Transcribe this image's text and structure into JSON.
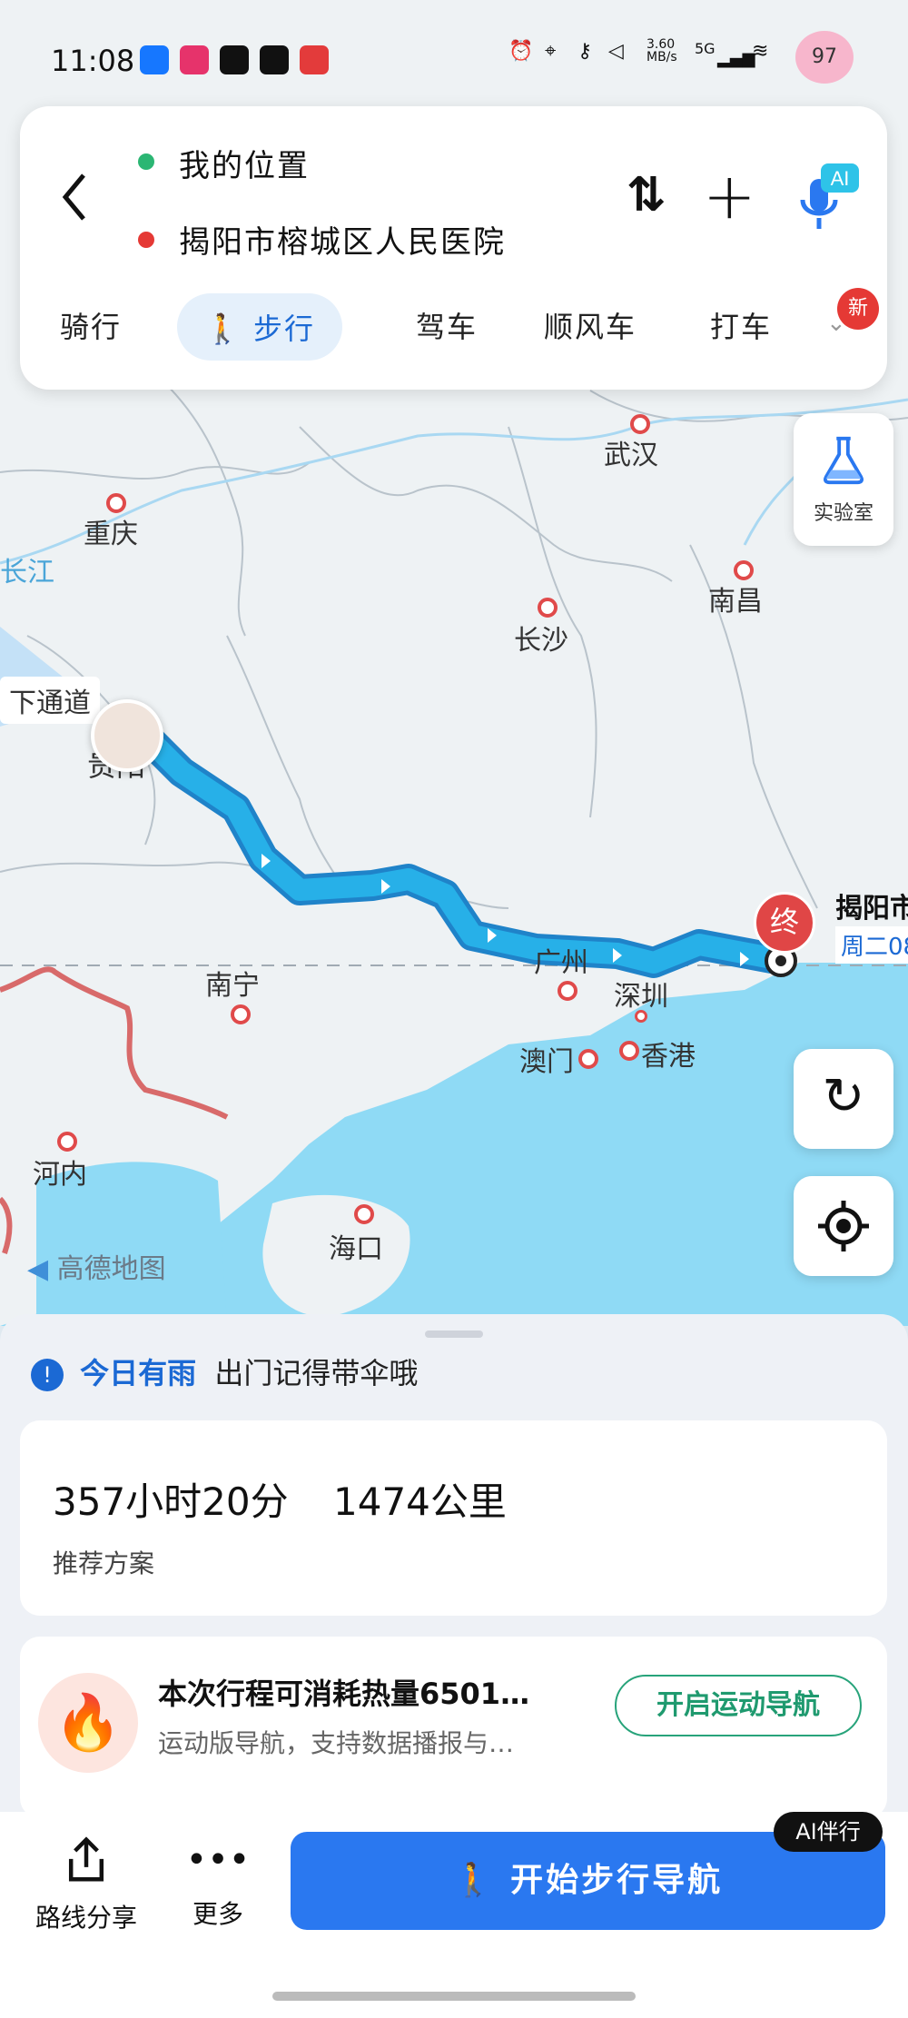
{
  "status_bar": {
    "time": "11:08",
    "network_speed": "3.60",
    "network_unit": "MB/s",
    "signal": "5G",
    "battery": "97"
  },
  "route_card": {
    "origin": "我的位置",
    "destination": "揭阳市榕城区人民医院",
    "tabs": [
      "骑行",
      "步行",
      "驾车",
      "顺风车",
      "打车"
    ],
    "active_tab": "步行",
    "new_badge": "新",
    "ai_badge": "AI"
  },
  "map": {
    "cities": [
      "重庆",
      "武汉",
      "长沙",
      "南昌",
      "南宁",
      "广州",
      "深圳",
      "澳门",
      "香港",
      "河内",
      "海口"
    ],
    "river": "长江",
    "partial_label": "下通道",
    "dest_label": "揭阳市",
    "dest_marker": "终",
    "dest_time": "周二08",
    "city_label_guiyang": "贵阳",
    "watermark": "高德地图",
    "lab_label": "实验室"
  },
  "sheet": {
    "notice_title": "今日有雨",
    "notice_text": "出门记得带伞哦",
    "duration": "357小时20分",
    "distance": "1474公里",
    "recommend": "推荐方案",
    "calorie_title": "本次行程可消耗热量6501…",
    "calorie_sub": "运动版导航，支持数据播报与…",
    "sport_nav_button": "开启运动导航"
  },
  "bottom_bar": {
    "share_label": "路线分享",
    "more_label": "更多",
    "start_button": "开始步行导航",
    "ai_companion": "AI伴行"
  },
  "colors": {
    "route": "#27b0e8",
    "accent": "#1b69d4",
    "start_button": "#2a78f0",
    "origin_dot": "#2bb673",
    "dest_dot": "#e53935",
    "sea": "#8fdaf5"
  }
}
